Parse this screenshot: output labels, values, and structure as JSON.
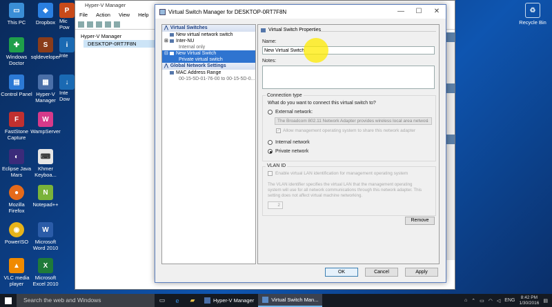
{
  "desktop": {
    "icons_left": [
      {
        "label": "This PC",
        "icon": "computer-icon",
        "color": "#3a8ed6"
      },
      {
        "label": "Windows Doctor",
        "icon": "doctor-icon",
        "color": "#1f9f4a"
      },
      {
        "label": "Control Panel",
        "icon": "control-panel-icon",
        "color": "#2c7ad6"
      },
      {
        "label": "FastStone Capture",
        "icon": "faststone-icon",
        "color": "#c03030"
      },
      {
        "label": "Eclipse Java Mars",
        "icon": "eclipse-icon",
        "color": "#3b2b7a"
      },
      {
        "label": "Mozilla Firefox",
        "icon": "firefox-icon",
        "color": "#e66a1a"
      },
      {
        "label": "PowerISO",
        "icon": "poweriso-icon",
        "color": "#e6b31a"
      },
      {
        "label": "VLC media player",
        "icon": "vlc-icon",
        "color": "#f08a00"
      }
    ],
    "icons_mid": [
      {
        "label": "Dropbox",
        "icon": "dropbox-icon",
        "color": "#2a7fe0"
      },
      {
        "label": "sqldeveloper",
        "icon": "sqldeveloper-icon",
        "color": "#8a3c1a"
      },
      {
        "label": "Hyper-V Manager",
        "icon": "hyperv-icon",
        "color": "#4a6fa8"
      },
      {
        "label": "WampServer",
        "icon": "wamp-icon",
        "color": "#d63a8a"
      },
      {
        "label": "Khmer Keyboa...",
        "icon": "keyboard-icon",
        "color": "#e6e6e6"
      },
      {
        "label": "Notepad++",
        "icon": "notepadpp-icon",
        "color": "#7ab33a"
      },
      {
        "label": "Microsoft Word 2010",
        "icon": "word-icon",
        "color": "#2b5ca8"
      },
      {
        "label": "Microsoft Excel 2010",
        "icon": "excel-icon",
        "color": "#1f7a3a"
      }
    ],
    "icons_partial": [
      {
        "label": "Mic Pow",
        "icon": "powerpoint-icon",
        "color": "#c84a1a"
      },
      {
        "label": "Inte",
        "icon": "intel-icon",
        "color": "#1a6ab3"
      },
      {
        "label": "Inte Dow",
        "icon": "download-icon",
        "color": "#1a6ab3"
      }
    ],
    "recycle_bin": "Recycle Bin"
  },
  "hyperv": {
    "title": "Hyper-V Manager",
    "menu": [
      "File",
      "Action",
      "View",
      "Help"
    ],
    "tree": [
      "Hyper-V Manager",
      "DESKTOP-0RT7F8N"
    ]
  },
  "dialog": {
    "title": "Virtual Switch Manager for DESKTOP-0RT7F8N",
    "left": {
      "section1": "Virtual Switches",
      "new_switch": "New virtual network switch",
      "inter_nu": "Inter-NU",
      "inter_nu_sub": "Internal only",
      "selected": "New Virtual Switch",
      "selected_sub": "Private virtual switch",
      "section2": "Global Network Settings",
      "mac_range": "MAC Address Range",
      "mac_value": "00-15-5D-01-76-00 to 00-15-5D-0..."
    },
    "right": {
      "header": "Virtual Switch Properties",
      "name_label": "Name:",
      "name_value": "New Virtual Switch",
      "notes_label": "Notes:",
      "conn_type": "Connection type",
      "conn_question": "What do you want to connect this virtual switch to?",
      "external": "External network:",
      "adapter": "The Broadcom 802.11 Network Adapter provides wireless local area networl",
      "allow_mgmt": "Allow management operating system to share this network adapter",
      "internal": "Internal network",
      "private": "Private network",
      "vlan_head": "VLAN ID",
      "vlan_enable": "Enable virtual LAN identification for management operating system",
      "vlan_desc1": "The VLAN identifier specifies the virtual LAN that the management operating",
      "vlan_desc2": "system will use for all network communications through this network adapter. This",
      "vlan_desc3": "setting does not affect virtual machine networking.",
      "vlan_value": "2",
      "remove": "Remove"
    },
    "buttons": {
      "ok": "OK",
      "cancel": "Cancel",
      "apply": "Apply"
    }
  },
  "taskbar": {
    "search": "Search the web and Windows",
    "apps": [
      "Hyper-V Manager",
      "Virtual Switch Man..."
    ],
    "lang": "ENG",
    "time": "8:42 PM",
    "date": "1/30/2016"
  }
}
